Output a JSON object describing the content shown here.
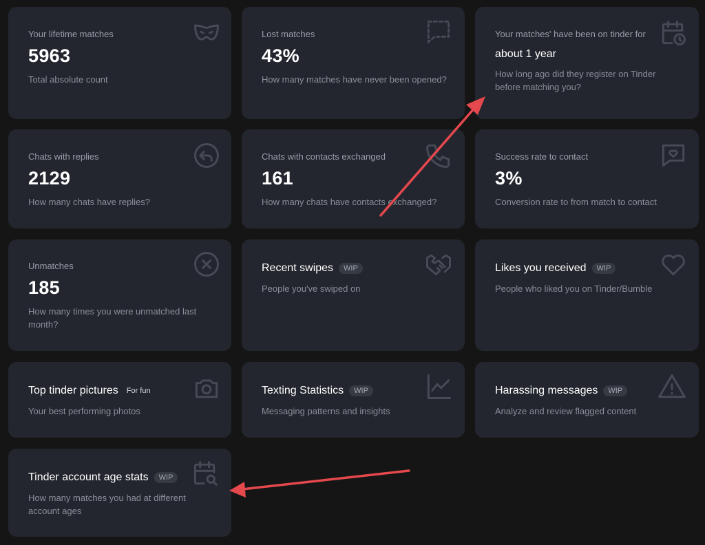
{
  "cards": {
    "lifetime": {
      "label": "Your lifetime matches",
      "value": "5963",
      "desc": "Total absolute count",
      "icon": "mask-icon"
    },
    "lost": {
      "label": "Lost matches",
      "value": "43%",
      "desc": "How many matches have never been opened?",
      "icon": "dashed-message-icon"
    },
    "on_tinder": {
      "label": "Your matches' have been on tinder for",
      "value": "about 1 year",
      "desc": "How long ago did they register on Tinder before matching you?",
      "icon": "calendar-clock-icon"
    },
    "chats_replies": {
      "label": "Chats with replies",
      "value": "2129",
      "desc": "How many chats have replies?",
      "icon": "reply-icon"
    },
    "contacts": {
      "label": "Chats with contacts exchanged",
      "value": "161",
      "desc": "How many chats have contacts exchanged?",
      "icon": "phone-icon"
    },
    "success": {
      "label": "Success rate to contact",
      "value": "3%",
      "desc": "Conversion rate to from match to contact",
      "icon": "heart-message-icon"
    },
    "unmatches": {
      "label": "Unmatches",
      "value": "185",
      "desc": "How many times you were unmatched last month?",
      "icon": "close-circle-icon"
    },
    "recent_swipes": {
      "title": "Recent swipes",
      "badge": "WIP",
      "desc": "People you've swiped on",
      "icon": "handshake-icon"
    },
    "likes": {
      "title": "Likes you received",
      "badge": "WIP",
      "desc": "People who liked you on Tinder/Bumble",
      "icon": "heart-icon"
    },
    "top_pictures": {
      "title": "Top tinder pictures",
      "badge": "For fun",
      "desc": "Your best performing photos",
      "icon": "camera-icon"
    },
    "texting": {
      "title": "Texting Statistics",
      "badge": "WIP",
      "desc": "Messaging patterns and insights",
      "icon": "line-chart-icon"
    },
    "harassing": {
      "title": "Harassing messages",
      "badge": "WIP",
      "desc": "Analyze and review flagged content",
      "icon": "warning-icon"
    },
    "account_age": {
      "title": "Tinder account age stats",
      "badge": "WIP",
      "desc": "How many matches you had at different account ages",
      "icon": "calendar-search-icon"
    }
  },
  "colors": {
    "background": "#151515",
    "card": "#23262e",
    "arrow": "#e5484d"
  }
}
